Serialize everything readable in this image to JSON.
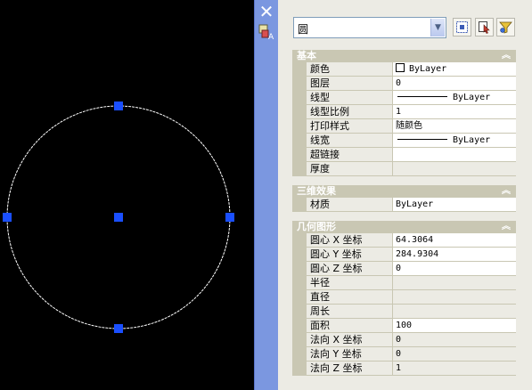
{
  "object_selector": {
    "value": "圆"
  },
  "sections": {
    "basic": {
      "title": "基本",
      "rows": [
        {
          "name": "颜色",
          "value": "ByLayer",
          "kind": "color"
        },
        {
          "name": "图层",
          "value": "0"
        },
        {
          "name": "线型",
          "value": "ByLayer",
          "kind": "linetype"
        },
        {
          "name": "线型比例",
          "value": "1"
        },
        {
          "name": "打印样式",
          "value": "随颜色"
        },
        {
          "name": "线宽",
          "value": "ByLayer",
          "kind": "linetype"
        },
        {
          "name": "超链接",
          "value": ""
        },
        {
          "name": "厚度",
          "value": "",
          "readonly": true
        }
      ]
    },
    "three_d": {
      "title": "三维效果",
      "rows": [
        {
          "name": "材质",
          "value": "ByLayer"
        }
      ]
    },
    "geometry": {
      "title": "几何图形",
      "rows": [
        {
          "name": "圆心 X 坐标",
          "value": "64.3064"
        },
        {
          "name": "圆心 Y 坐标",
          "value": "284.9304"
        },
        {
          "name": "圆心 Z 坐标",
          "value": "0"
        },
        {
          "name": "半径",
          "value": "",
          "readonly": true
        },
        {
          "name": "直径",
          "value": "",
          "readonly": true
        },
        {
          "name": "周长",
          "value": "",
          "readonly": true
        },
        {
          "name": "面积",
          "value": "100"
        },
        {
          "name": "法向 X 坐标",
          "value": "0",
          "readonly": true
        },
        {
          "name": "法向 Y 坐标",
          "value": "0",
          "readonly": true
        },
        {
          "name": "法向 Z 坐标",
          "value": "1",
          "readonly": true
        }
      ]
    }
  },
  "colors": {
    "canvas_bg": "#000000",
    "circle_stroke": "#ffffff",
    "grip_fill": "#1a4fff",
    "palette_strip": "#7b97e0",
    "panel_bg": "#ecebe4",
    "section_header_bg": "#c9c7b3"
  },
  "icons": {
    "close": "close-icon",
    "properties": "properties-icon",
    "dropdown": "chevron-down-icon",
    "quick_select": "quick-select-icon",
    "select_objects": "select-objects-icon",
    "toggle_pickadd": "toggle-pickadd-icon",
    "collapse": "collapse-icon"
  }
}
